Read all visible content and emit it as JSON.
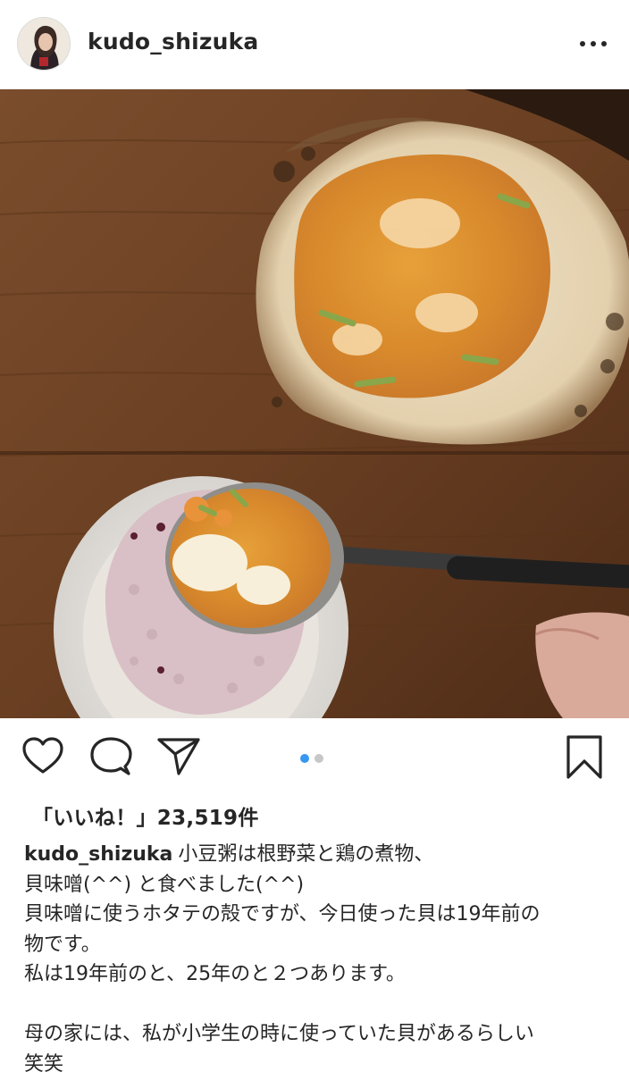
{
  "post": {
    "username": "kudo_shizuka",
    "likes_label": "「いいね！」23,519件",
    "carousel": {
      "count": 2,
      "active_index": 0
    }
  },
  "caption": {
    "username": "kudo_shizuka",
    "lines": [
      "小豆粥は根野菜と鶏の煮物、",
      "貝味噌(^^) と食べました(^^)",
      "貝味噌に使うホタテの殻ですが、今日使った貝は19年前の",
      "物です。",
      "私は19年前のと、25年のと２つあります。",
      "",
      "母の家には、私が小学生の時に使っていた貝があるらしい",
      "笑笑"
    ]
  },
  "icons": {
    "more": "more-horizontal-icon",
    "like": "heart-icon",
    "comment": "comment-icon",
    "share": "paper-plane-icon",
    "save": "bookmark-icon"
  },
  "colors": {
    "text": "#262626",
    "carousel_active": "#3897f0",
    "carousel_inactive": "#c7c7c7"
  }
}
